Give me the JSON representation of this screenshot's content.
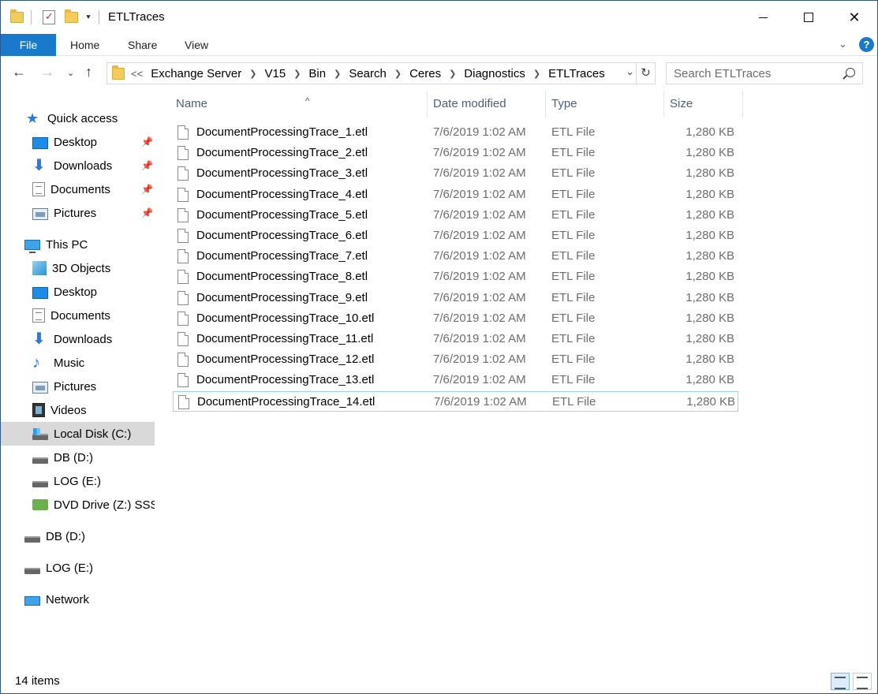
{
  "window": {
    "title": "ETLTraces"
  },
  "ribbon": {
    "tabs": [
      "File",
      "Home",
      "Share",
      "View"
    ]
  },
  "address": {
    "lead": "<<",
    "crumbs": [
      "Exchange Server",
      "V15",
      "Bin",
      "Search",
      "Ceres",
      "Diagnostics",
      "ETLTraces"
    ]
  },
  "search": {
    "placeholder": "Search ETLTraces"
  },
  "nav": {
    "items": [
      {
        "label": "Quick access",
        "icon": "star-icon"
      },
      {
        "label": "Desktop",
        "icon": "desktop-icon",
        "pinned": true
      },
      {
        "label": "Downloads",
        "icon": "download-icon",
        "pinned": true
      },
      {
        "label": "Documents",
        "icon": "documents-icon",
        "pinned": true
      },
      {
        "label": "Pictures",
        "icon": "pictures-icon",
        "pinned": true
      },
      {
        "label": "This PC",
        "icon": "computer-icon"
      },
      {
        "label": "3D Objects",
        "icon": "3d-objects-icon"
      },
      {
        "label": "Desktop",
        "icon": "desktop-icon"
      },
      {
        "label": "Documents",
        "icon": "documents-icon"
      },
      {
        "label": "Downloads",
        "icon": "download-icon"
      },
      {
        "label": "Music",
        "icon": "music-icon"
      },
      {
        "label": "Pictures",
        "icon": "pictures-icon"
      },
      {
        "label": "Videos",
        "icon": "videos-icon"
      },
      {
        "label": "Local Disk (C:)",
        "icon": "os-disk-icon",
        "selected": true
      },
      {
        "label": "DB (D:)",
        "icon": "drive-icon"
      },
      {
        "label": "LOG (E:)",
        "icon": "drive-icon"
      },
      {
        "label": "DVD Drive (Z:) SSS_",
        "icon": "dvd-drive-icon"
      },
      {
        "label": "DB (D:)",
        "icon": "drive-icon"
      },
      {
        "label": "LOG (E:)",
        "icon": "drive-icon"
      },
      {
        "label": "Network",
        "icon": "network-icon"
      }
    ]
  },
  "columns": {
    "name": "Name",
    "date": "Date modified",
    "type": "Type",
    "size": "Size"
  },
  "files": [
    {
      "name": "DocumentProcessingTrace_1.etl",
      "date": "7/6/2019 1:02 AM",
      "type": "ETL File",
      "size": "1,280 KB"
    },
    {
      "name": "DocumentProcessingTrace_2.etl",
      "date": "7/6/2019 1:02 AM",
      "type": "ETL File",
      "size": "1,280 KB"
    },
    {
      "name": "DocumentProcessingTrace_3.etl",
      "date": "7/6/2019 1:02 AM",
      "type": "ETL File",
      "size": "1,280 KB"
    },
    {
      "name": "DocumentProcessingTrace_4.etl",
      "date": "7/6/2019 1:02 AM",
      "type": "ETL File",
      "size": "1,280 KB"
    },
    {
      "name": "DocumentProcessingTrace_5.etl",
      "date": "7/6/2019 1:02 AM",
      "type": "ETL File",
      "size": "1,280 KB"
    },
    {
      "name": "DocumentProcessingTrace_6.etl",
      "date": "7/6/2019 1:02 AM",
      "type": "ETL File",
      "size": "1,280 KB"
    },
    {
      "name": "DocumentProcessingTrace_7.etl",
      "date": "7/6/2019 1:02 AM",
      "type": "ETL File",
      "size": "1,280 KB"
    },
    {
      "name": "DocumentProcessingTrace_8.etl",
      "date": "7/6/2019 1:02 AM",
      "type": "ETL File",
      "size": "1,280 KB"
    },
    {
      "name": "DocumentProcessingTrace_9.etl",
      "date": "7/6/2019 1:02 AM",
      "type": "ETL File",
      "size": "1,280 KB"
    },
    {
      "name": "DocumentProcessingTrace_10.etl",
      "date": "7/6/2019 1:02 AM",
      "type": "ETL File",
      "size": "1,280 KB"
    },
    {
      "name": "DocumentProcessingTrace_11.etl",
      "date": "7/6/2019 1:02 AM",
      "type": "ETL File",
      "size": "1,280 KB"
    },
    {
      "name": "DocumentProcessingTrace_12.etl",
      "date": "7/6/2019 1:02 AM",
      "type": "ETL File",
      "size": "1,280 KB"
    },
    {
      "name": "DocumentProcessingTrace_13.etl",
      "date": "7/6/2019 1:02 AM",
      "type": "ETL File",
      "size": "1,280 KB"
    },
    {
      "name": "DocumentProcessingTrace_14.etl",
      "date": "7/6/2019 1:02 AM",
      "type": "ETL File",
      "size": "1,280 KB",
      "focused": true
    }
  ],
  "status": {
    "items": "14 items"
  },
  "colors": {
    "accent": "#1979ca",
    "selection": "#d9d9d9",
    "header_text": "#4c607a"
  }
}
